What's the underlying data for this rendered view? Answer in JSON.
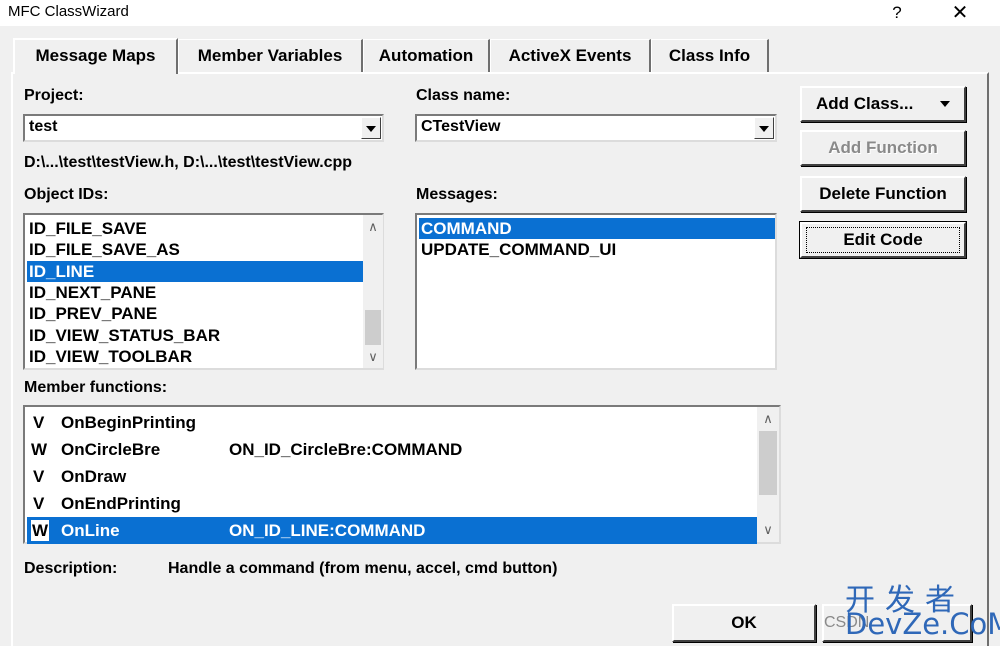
{
  "window": {
    "title": "MFC ClassWizard",
    "help": "?",
    "close": "✕"
  },
  "tabs": [
    {
      "label": "Message Maps",
      "active": true
    },
    {
      "label": "Member Variables"
    },
    {
      "label": "Automation"
    },
    {
      "label": "ActiveX Events"
    },
    {
      "label": "Class Info"
    }
  ],
  "project": {
    "label": "Project:",
    "value": "test"
  },
  "class_name": {
    "label": "Class name:",
    "value": "CTestView"
  },
  "file_path": "D:\\...\\test\\testView.h, D:\\...\\test\\testView.cpp",
  "object_ids": {
    "label": "Object IDs:",
    "items": [
      "ID_FILE_SAVE",
      "ID_FILE_SAVE_AS",
      "ID_LINE",
      "ID_NEXT_PANE",
      "ID_PREV_PANE",
      "ID_VIEW_STATUS_BAR",
      "ID_VIEW_TOOLBAR"
    ],
    "selected": "ID_LINE"
  },
  "messages": {
    "label": "Messages:",
    "items": [
      "COMMAND",
      "UPDATE_COMMAND_UI"
    ],
    "selected": "COMMAND"
  },
  "buttons": {
    "add_class": "Add Class...",
    "add_function": "Add Function",
    "delete_function": "Delete Function",
    "edit_code": "Edit Code",
    "ok": "OK"
  },
  "member_functions": {
    "label": "Member functions:",
    "rows": [
      {
        "flag": "V",
        "name": "OnBeginPrinting",
        "map": ""
      },
      {
        "flag": "W",
        "name": "OnCircleBre",
        "map": "ON_ID_CircleBre:COMMAND"
      },
      {
        "flag": "V",
        "name": "OnDraw",
        "map": ""
      },
      {
        "flag": "V",
        "name": "OnEndPrinting",
        "map": ""
      },
      {
        "flag": "W",
        "name": "OnLine",
        "map": "ON_ID_LINE:COMMAND",
        "selected": true
      }
    ]
  },
  "description": {
    "label": "Description:",
    "text": "Handle a command (from menu, accel, cmd button)"
  },
  "watermark": {
    "line1": "开发者",
    "line2": "DevZe.CoM",
    "csdn": "CSDN"
  }
}
